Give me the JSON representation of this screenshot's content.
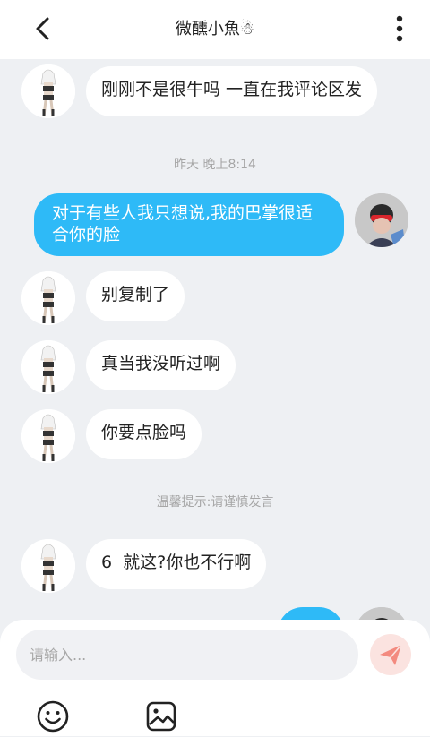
{
  "header": {
    "title": "微醺小魚☃"
  },
  "messages": [
    {
      "side": "left",
      "text": "刚刚不是很牛吗 一直在我评论区发"
    },
    {
      "side": "time",
      "text": "昨天 晚上8:14"
    },
    {
      "side": "right",
      "text": " 对于有些人我只想说,我的巴掌很适合你的脸"
    },
    {
      "side": "left",
      "text": "别复制了"
    },
    {
      "side": "left",
      "text": "真当我没听过啊"
    },
    {
      "side": "left",
      "text": "你要点脸吗"
    },
    {
      "side": "time",
      "text": "温馨提示:请谨慎发言"
    },
    {
      "side": "left",
      "text": "6  就这?你也不行啊"
    }
  ],
  "input": {
    "placeholder": "请输入..."
  },
  "colors": {
    "accent": "#2ebaf7",
    "send_bg": "#fbe3e0",
    "send_icon": "#f38a7f"
  },
  "icons": [
    "back-arrow-icon",
    "more-vertical-icon",
    "send-icon",
    "emoji-icon",
    "image-icon"
  ]
}
